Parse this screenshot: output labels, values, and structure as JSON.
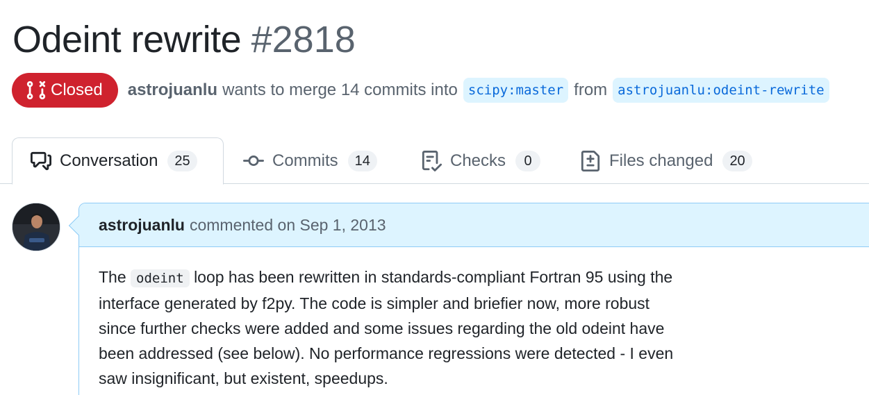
{
  "pr": {
    "title": "Odeint rewrite",
    "number": "#2818",
    "state": "Closed",
    "author": "astrojuanlu",
    "merge_text": "wants to merge 14 commits into",
    "base_branch": "scipy:master",
    "from_text": "from",
    "head_branch": "astrojuanlu:odeint-rewrite"
  },
  "tabs": [
    {
      "label": "Conversation",
      "count": "25",
      "icon": "comment-discussion-icon"
    },
    {
      "label": "Commits",
      "count": "14",
      "icon": "git-commit-icon"
    },
    {
      "label": "Checks",
      "count": "0",
      "icon": "checklist-icon"
    },
    {
      "label": "Files changed",
      "count": "20",
      "icon": "file-diff-icon"
    }
  ],
  "comment": {
    "author": "astrojuanlu",
    "action": "commented on Sep 1, 2013",
    "body_prefix": "The",
    "code_word": "odeint",
    "body_rest": "loop has been rewritten in standards-compliant Fortran 95 using the interface generated by f2py. The code is simpler and briefier now, more robust since further checks were added and some issues regarding the old odeint have been addressed (see below). No performance regressions were detected - I even saw insignificant, but existent, speedups."
  },
  "colors": {
    "closed": "#cf222e",
    "link": "#0969da",
    "branch_bg": "#ddf4ff",
    "header_bg": "#ddf4ff",
    "border": "#8ecbf6"
  }
}
